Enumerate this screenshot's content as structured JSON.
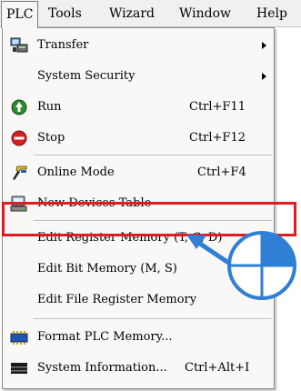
{
  "menubar": {
    "items": [
      {
        "label": "PLC",
        "active": true
      },
      {
        "label": "Tools"
      },
      {
        "label": "Wizard"
      },
      {
        "label": "Window"
      },
      {
        "label": "Help"
      }
    ]
  },
  "menu": {
    "items": [
      {
        "label": "Transfer",
        "shortcut": "",
        "icon": "transfer-icon",
        "submenu": true
      },
      {
        "label": "System Security",
        "shortcut": "",
        "icon": "",
        "submenu": true
      },
      {
        "label": "Run",
        "shortcut": "Ctrl+F11",
        "icon": "run-icon"
      },
      {
        "label": "Stop",
        "shortcut": "Ctrl+F12",
        "icon": "stop-icon"
      },
      {
        "label": "Online Mode",
        "shortcut": "Ctrl+F4",
        "icon": "online-mode-icon"
      },
      {
        "label": "New Devices Table",
        "shortcut": "",
        "icon": "devices-table-icon"
      },
      {
        "label": "Edit Register Memory (T, C, D)",
        "shortcut": "",
        "icon": "",
        "highlighted": true
      },
      {
        "label": "Edit Bit Memory (M, S)",
        "shortcut": "",
        "icon": ""
      },
      {
        "label": "Edit File Register Memory",
        "shortcut": "",
        "icon": ""
      },
      {
        "label": "Format PLC Memory...",
        "shortcut": "",
        "icon": "format-memory-icon"
      },
      {
        "label": "System Information...",
        "shortcut": "Ctrl+Alt+I",
        "icon": "system-info-icon"
      }
    ]
  },
  "colors": {
    "highlight_border": "#e11b22",
    "pointer_arrow": "#2f7fd6",
    "mouse_fill": "#2f7fd6"
  }
}
